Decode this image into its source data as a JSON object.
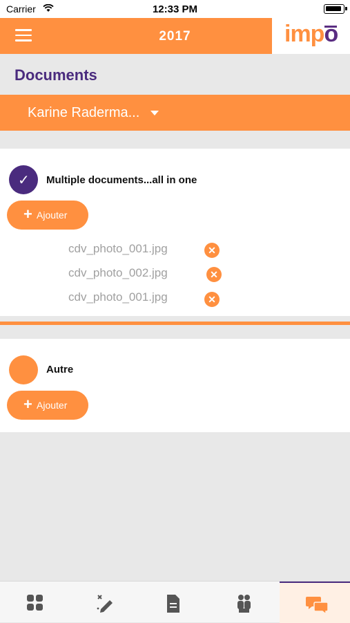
{
  "status_bar": {
    "carrier": "Carrier",
    "time": "12:33 PM"
  },
  "header": {
    "year": "2017",
    "logo_part1": "imp",
    "logo_part2": "o"
  },
  "page": {
    "title": "Documents"
  },
  "person_selector": {
    "name": "Karine Raderma..."
  },
  "sections": [
    {
      "title": "Multiple documents...all in one",
      "checked": true,
      "add_label": "Ajouter",
      "files": [
        "cdv_photo_001.jpg",
        "cdv_photo_002.jpg",
        "cdv_photo_001.jpg"
      ]
    },
    {
      "title": "Autre",
      "checked": false,
      "add_label": "Ajouter",
      "files": []
    }
  ],
  "tabs": [
    {
      "icon": "dashboard-icon",
      "active": false
    },
    {
      "icon": "edit-icon",
      "active": false
    },
    {
      "icon": "document-icon",
      "active": false
    },
    {
      "icon": "people-icon",
      "active": false
    },
    {
      "icon": "chat-icon",
      "active": true
    }
  ],
  "colors": {
    "accent": "#ff9040",
    "brand": "#4a2b7e",
    "background": "#e8e8e8"
  }
}
